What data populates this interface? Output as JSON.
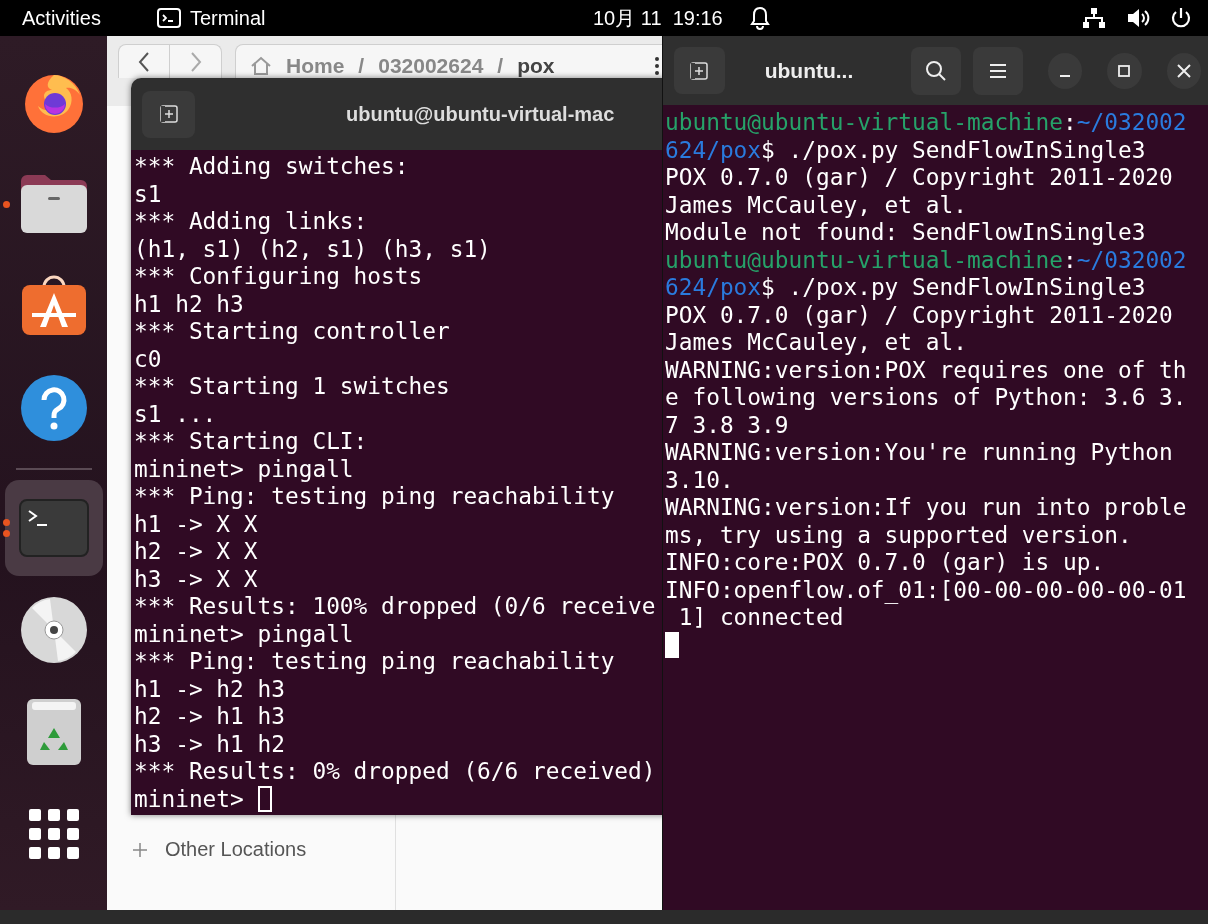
{
  "top_bar": {
    "activities": "Activities",
    "app_name": "Terminal",
    "date": "10月 11",
    "time": "19:16"
  },
  "dock": {
    "items": [
      {
        "kind": "firefox",
        "running": false,
        "selected": false
      },
      {
        "kind": "files",
        "running": true,
        "several_windows": false,
        "selected": false
      },
      {
        "kind": "software",
        "running": false,
        "selected": false
      },
      {
        "kind": "help",
        "running": false,
        "selected": false
      },
      {
        "kind": "separator"
      },
      {
        "kind": "terminal",
        "running": true,
        "several_windows": true,
        "selected": true
      },
      {
        "kind": "disc",
        "running": false,
        "selected": false
      },
      {
        "kind": "trash",
        "running": false,
        "selected": false
      },
      {
        "kind": "apps",
        "running": false,
        "selected": false
      }
    ]
  },
  "files_window": {
    "path": [
      "Home",
      "032002624",
      "pox"
    ],
    "path_separator": "/",
    "sidebar": [
      {
        "label": "Other Locations"
      }
    ]
  },
  "left_terminal": {
    "title": "ubuntu@ubuntu-virtual-mac",
    "focused": false,
    "lines": [
      "*** Adding switches:",
      "s1",
      "*** Adding links:",
      "(h1, s1) (h2, s1) (h3, s1)",
      "*** Configuring hosts",
      "h1 h2 h3",
      "*** Starting controller",
      "c0",
      "*** Starting 1 switches",
      "s1 ...",
      "*** Starting CLI:",
      "mininet> pingall",
      "*** Ping: testing ping reachability",
      "h1 -> X X",
      "h2 -> X X",
      "h3 -> X X",
      "*** Results: 100% dropped (0/6 receive",
      "mininet> pingall",
      "*** Ping: testing ping reachability",
      "h1 -> h2 h3",
      "h2 -> h1 h3",
      "h3 -> h1 h2",
      "*** Results: 0% dropped (6/6 received)",
      "mininet> "
    ]
  },
  "right_terminal": {
    "title": "ubuntu...",
    "focused": true,
    "lines": [
      [
        {
          "kind": "user",
          "text": "ubuntu@ubuntu-virtual-machine"
        },
        {
          "kind": "text",
          "text": ":"
        },
        {
          "kind": "path",
          "text": "~/032002"
        }
      ],
      [
        {
          "kind": "path",
          "text": "624/pox"
        },
        {
          "kind": "text",
          "text": "$ ./pox.py SendFlowInSingle3"
        }
      ],
      [
        {
          "kind": "text",
          "text": "POX 0.7.0 (gar) / Copyright 2011-2020"
        }
      ],
      [
        {
          "kind": "text",
          "text": "James McCauley, et al."
        }
      ],
      [
        {
          "kind": "text",
          "text": "Module not found: SendFlowInSingle3"
        }
      ],
      [
        {
          "kind": "user",
          "text": "ubuntu@ubuntu-virtual-machine"
        },
        {
          "kind": "text",
          "text": ":"
        },
        {
          "kind": "path",
          "text": "~/032002"
        }
      ],
      [
        {
          "kind": "path",
          "text": "624/pox"
        },
        {
          "kind": "text",
          "text": "$ ./pox.py SendFlowInSingle3"
        }
      ],
      [
        {
          "kind": "text",
          "text": "POX 0.7.0 (gar) / Copyright 2011-2020"
        }
      ],
      [
        {
          "kind": "text",
          "text": "James McCauley, et al."
        }
      ],
      [
        {
          "kind": "text",
          "text": "WARNING:version:POX requires one of th"
        }
      ],
      [
        {
          "kind": "text",
          "text": "e following versions of Python: 3.6 3."
        }
      ],
      [
        {
          "kind": "text",
          "text": "7 3.8 3.9"
        }
      ],
      [
        {
          "kind": "text",
          "text": "WARNING:version:You're running Python"
        }
      ],
      [
        {
          "kind": "text",
          "text": "3.10."
        }
      ],
      [
        {
          "kind": "text",
          "text": "WARNING:version:If you run into proble"
        }
      ],
      [
        {
          "kind": "text",
          "text": "ms, try using a supported version."
        }
      ],
      [
        {
          "kind": "text",
          "text": "INFO:core:POX 0.7.0 (gar) is up."
        }
      ],
      [
        {
          "kind": "text",
          "text": "INFO:openflow.of_01:[00-00-00-00-00-01"
        }
      ],
      [
        {
          "kind": "text",
          "text": " 1] connected"
        }
      ]
    ]
  }
}
